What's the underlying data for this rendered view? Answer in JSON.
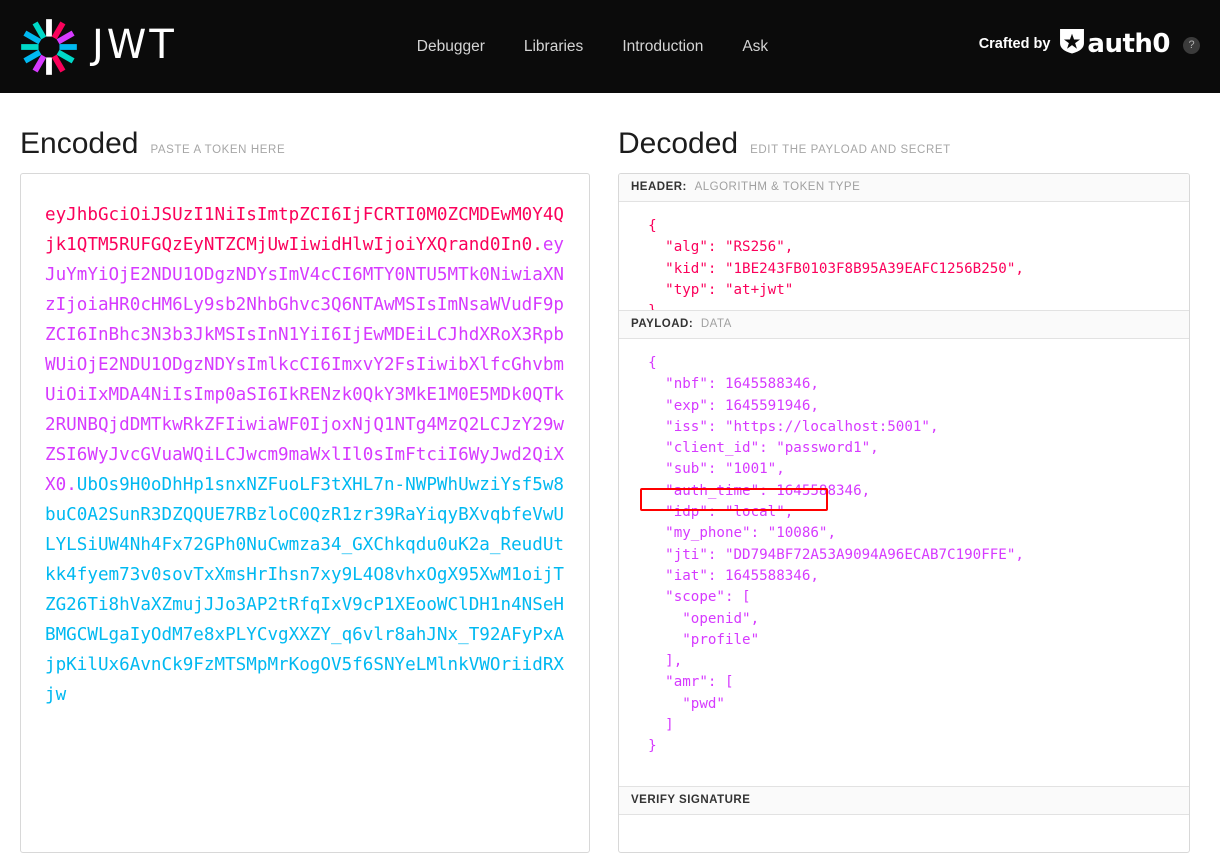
{
  "navbar": {
    "logo_icon": "jwt-starburst-logo-icon",
    "wordmark": "JWT",
    "links": [
      {
        "label": "Debugger"
      },
      {
        "label": "Libraries"
      },
      {
        "label": "Introduction"
      },
      {
        "label": "Ask"
      }
    ],
    "crafted_by": "Crafted by",
    "auth0_text": "auth0",
    "auth0_icon": "auth0-shield-icon",
    "help_badge": "?",
    "background_color": "#0b0b0b"
  },
  "encoded": {
    "title": "Encoded",
    "subtitle": "PASTE A TOKEN HERE",
    "token": {
      "header_b64": "eyJhbGciOiJSUzI1NiIsImtpZCI6IjFCRTI0M0ZCMDEwM0Y4Qjk1QTM5RUFGQzEyNTZCMjUwIiwidHlwIjoiYXQrand0In0",
      "separator_1": ".",
      "payload_b64": "eyJuYmYiOjE2NDU1ODgzNDYsImV4cCI6MTY0NTU5MTk0NiwiaXNzIjoiaHR0cHM6Ly9sb2NhbGhvc3Q6NTAwMSIsImNsaWVudF9pZCI6InBhc3N3b3JkMSIsInN1YiI6IjEwMDEiLCJhdXRoX3RpbWUiOjE2NDU1ODgzNDYsImlkcCI6ImxvY2FsIiwibXlfcGhvbmUiOiIxMDA4NiIsImp0aSI6IkRENzk0QkY3MkE1M0E5MDk0QTk2RUNBQjdDMTkwRkZFIiwiaWF0IjoxNjQ1NTg4MzQ2LCJzY29wZSI6WyJvcGVuaWQiLCJwcm9maWxlIl0sImFtciI6WyJwd2QiXX0",
      "separator_2": ".",
      "signature_b64": "UbOs9H0oDhHp1snxNZFuoLF3tXHL7n-NWPWhUwziYsf5w8buC0A2SunR3DZQQUE7RBzloC0QzR1zr39RaYiqyBXvqbfeVwULYLSiUW4Nh4Fx72GPh0NuCwmza34_GXChkqdu0uK2a_ReudUtkk4fyem73v0sovTxXmsHrIhsn7xy9L4O8vhxOgX95XwM1oijTZG26Ti8hVaXZmujJJo3AP2tRfqIxV9cP1XEooWClDH1n4NSeHBMGCWLgaIyOdM7e8xPLYCvgXXZY_q6vlr8ahJNx_T92AFyPxAjpKilUx6AvnCk9FzMTSMpMrKogOV5f6SNYeLMlnkVWOriidRXjw"
    },
    "colors": {
      "header": "#fb015b",
      "payload": "#d63aff",
      "signature": "#00b9f1"
    }
  },
  "decoded": {
    "title": "Decoded",
    "subtitle": "EDIT THE PAYLOAD AND SECRET",
    "sections": [
      {
        "key": "HEADER:",
        "value": "ALGORITHM & TOKEN TYPE",
        "json": "  {\n    \"alg\": \"RS256\",\n    \"kid\": \"1BE243FB0103F8B95A39EAFC1256B250\",\n    \"typ\": \"at+jwt\"\n  }"
      },
      {
        "key": "PAYLOAD:",
        "value": "DATA",
        "json": "  {\n    \"nbf\": 1645588346,\n    \"exp\": 1645591946,\n    \"iss\": \"https://localhost:5001\",\n    \"client_id\": \"password1\",\n    \"sub\": \"1001\",\n    \"auth_time\": 1645588346,\n    \"idp\": \"local\",\n    \"my_phone\": \"10086\",\n    \"jti\": \"DD794BF72A53A9094A96ECAB7C190FFE\",\n    \"iat\": 1645588346,\n    \"scope\": [\n      \"openid\",\n      \"profile\"\n    ],\n    \"amr\": [\n      \"pwd\"\n    ]\n  }"
      },
      {
        "key": "VERIFY SIGNATURE",
        "value": "",
        "json": ""
      }
    ],
    "annotation": {
      "target_claim": "\"my_phone\": \"10086\",",
      "color": "#ff0000"
    },
    "header_json_parsed": {
      "alg": "RS256",
      "kid": "1BE243FB0103F8B95A39EAFC1256B250",
      "typ": "at+jwt"
    },
    "payload_json_parsed": {
      "nbf": 1645588346,
      "exp": 1645591946,
      "iss": "https://localhost:5001",
      "client_id": "password1",
      "sub": "1001",
      "auth_time": 1645588346,
      "idp": "local",
      "my_phone": "10086",
      "jti": "DD794BF72A53A9094A96ECAB7C190FFE",
      "iat": 1645588346,
      "scope": [
        "openid",
        "profile"
      ],
      "amr": [
        "pwd"
      ]
    }
  }
}
